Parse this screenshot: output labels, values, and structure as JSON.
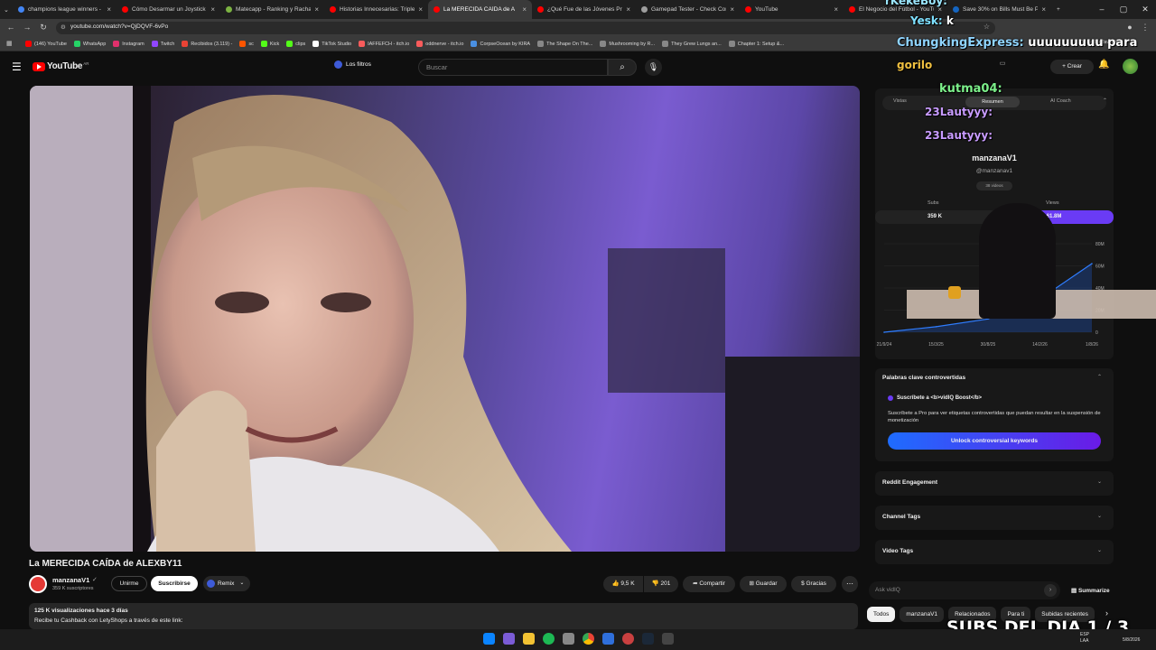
{
  "browser": {
    "tabs": [
      {
        "title": "champions league winners - B",
        "color": "#4285f4",
        "active": false
      },
      {
        "title": "Cómo Desarmar un Joystick d",
        "color": "#ff0000",
        "active": false
      },
      {
        "title": "Matecapp - Ranking y Racha",
        "color": "#7cb342",
        "active": false
      },
      {
        "title": "Historias Innecesarias: Triple !",
        "color": "#ff0000",
        "active": false
      },
      {
        "title": "La MERECIDA CAÍDA de A",
        "color": "#ff0000",
        "active": true
      },
      {
        "title": "¿Qué Fue de las Jóvenes Prom",
        "color": "#ff0000",
        "active": false
      },
      {
        "title": "Gamepad Tester - Check Con",
        "color": "#9e9e9e",
        "active": false
      },
      {
        "title": "YouTube",
        "color": "#ff0000",
        "active": false
      },
      {
        "title": "El Negocio del Fútbol - YouTu",
        "color": "#ff0000",
        "active": false
      },
      {
        "title": "Save 30% on Bills Must Be Pa",
        "color": "#1565c0",
        "active": false
      }
    ],
    "url": "youtube.com/watch?v=QjDQVF-6vPo",
    "bookmarks": [
      {
        "label": "(146) YouTube",
        "color": "#ff0000"
      },
      {
        "label": "WhatsApp",
        "color": "#25d366"
      },
      {
        "label": "Instagram",
        "color": "#e1306c"
      },
      {
        "label": "Twitch",
        "color": "#9146ff"
      },
      {
        "label": "Recibidos (3.119) -",
        "color": "#ea4335"
      },
      {
        "label": "sc",
        "color": "#ff5500"
      },
      {
        "label": "Kick",
        "color": "#53fc18"
      },
      {
        "label": "clips",
        "color": "#53fc18"
      },
      {
        "label": "TikTok Studio",
        "color": "#ffffff"
      },
      {
        "label": "IAFFEFCH - itch.io",
        "color": "#fa5c5c"
      },
      {
        "label": "oddnerve - itch.io",
        "color": "#fa5c5c"
      },
      {
        "label": "CorpseOcean by KIRA",
        "color": "#4a90e2"
      },
      {
        "label": "The Shape On The...",
        "color": "#888888"
      },
      {
        "label": "Mushrooming by R...",
        "color": "#888888"
      },
      {
        "label": "They Grew Lungs an...",
        "color": "#888888"
      },
      {
        "label": "Chapter 1: Setup &...",
        "color": "#888888"
      }
    ],
    "all_bookmarks": "Todos los favoritos"
  },
  "youtube": {
    "logo_text": "YouTube",
    "logo_country": "AR",
    "filters_label": "Los filtros",
    "search_placeholder": "Buscar",
    "create_label": "Crear",
    "video_title": "La MERECIDA CAÍDA de ALEXBY11",
    "channel_name": "manzanaV1",
    "subscribers": "359 K suscriptores",
    "join_label": "Unirme",
    "subscribe_label": "Suscribirse",
    "remix_label": "Remix",
    "likes": "9,5 K",
    "dislikes": "201",
    "share_label": "Compartir",
    "save_label": "Guardar",
    "thanks_label": "Gracias",
    "views_line": "125 K visualizaciones  hace 3 días",
    "description_line": "Recibe tu Cashback con LetyShops a través de este link:"
  },
  "vidiq": {
    "tabs": [
      "Vistas",
      "Resumen",
      "AI Coach"
    ],
    "channel_name": "manzanaV1",
    "channel_handle": "@manzanav1",
    "videos_count": "38 videos",
    "subs_label": "Subs",
    "views_label": "Views",
    "subs_value": "359 K",
    "views_value": "61.8M",
    "chart_data": {
      "type": "area",
      "x": [
        "21/9/24",
        "15/3/25",
        "30/8/25",
        "14/2/26",
        "1/8/26"
      ],
      "yticks": [
        "0",
        "20M",
        "40M",
        "60M",
        "80M"
      ],
      "series": [
        {
          "values": [
            0,
            5,
            12,
            30,
            62
          ]
        }
      ],
      "ylim": [
        0,
        80
      ]
    },
    "controversial_title": "Palabras clave controvertidas",
    "boost_title": "Suscríbete a <b>vidIQ Boost</b>",
    "boost_text": "Suscríbete a Pro para ver etiquetas controvertidas que puedan resultar en la suspensión de monetización",
    "unlock_label": "Unlock controversial keywords",
    "reddit_label": "Reddit Engagement",
    "channel_tags_label": "Channel Tags",
    "video_tags_label": "Video Tags",
    "ask_placeholder": "Ask vidIQ",
    "summarize_label": "Summarize"
  },
  "filter_chips": [
    "Todos",
    "manzanaV1",
    "Relacionados",
    "Para ti",
    "Subidas recientes"
  ],
  "overlay": {
    "chat": [
      {
        "user": "rKekeBoy:",
        "msg": ""
      },
      {
        "user": "Yesk:",
        "msg": "k"
      },
      {
        "user": "ChungkingExpress:",
        "msg": "uuuuuuuuu para"
      },
      {
        "user": "gorilo",
        "msg": ""
      },
      {
        "user": "kutma04:",
        "msg": ""
      },
      {
        "user": "23Lautyyy:",
        "msg": ""
      },
      {
        "user": "23Lautyyy:",
        "msg": ""
      }
    ],
    "subs_counter": "SUBS DEL DIA 1 / 3"
  },
  "taskbar": {
    "lang": "ESP LAA",
    "date": "5/8/2026"
  }
}
